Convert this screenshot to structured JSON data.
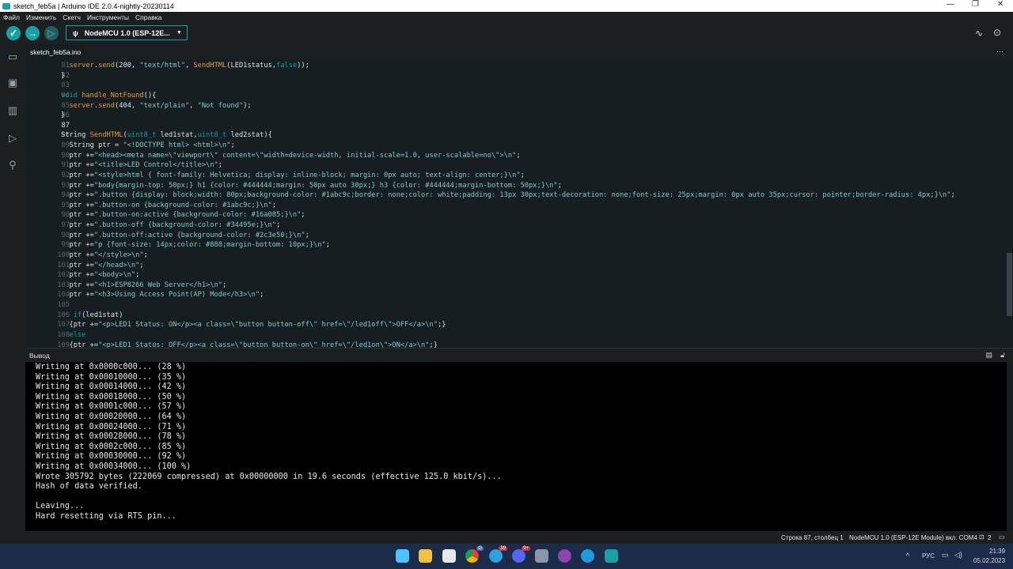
{
  "window": {
    "title": "sketch_feb5a | Arduino IDE 2.0.4-nightly-20230114"
  },
  "menu": [
    "Файл",
    "Изменить",
    "Скетч",
    "Инструменты",
    "Справка"
  ],
  "toolbar": {
    "board": "NodeMCU 1.0 (ESP-12E..."
  },
  "tab": {
    "label": "sketch_feb5a.ino"
  },
  "editor": {
    "current_line": 87,
    "lines": [
      {
        "n": 81,
        "t": [
          [
            "p",
            "  "
          ],
          [
            "f",
            "server"
          ],
          [
            "p",
            "."
          ],
          [
            "f",
            "send"
          ],
          [
            "p",
            "(200, "
          ],
          [
            "s",
            "\"text/html\""
          ],
          [
            "p",
            ", "
          ],
          [
            "f",
            "SendHTML"
          ],
          [
            "p",
            "(LED1status,"
          ],
          [
            "k",
            "false"
          ],
          [
            "p",
            "));"
          ]
        ]
      },
      {
        "n": 82,
        "t": [
          [
            "p",
            "}"
          ]
        ]
      },
      {
        "n": 83,
        "t": []
      },
      {
        "n": 84,
        "t": [
          [
            "k",
            "void"
          ],
          [
            "p",
            " "
          ],
          [
            "f",
            "handle_NotFound"
          ],
          [
            "p",
            "(){"
          ]
        ]
      },
      {
        "n": 85,
        "t": [
          [
            "p",
            "  "
          ],
          [
            "f",
            "server"
          ],
          [
            "p",
            "."
          ],
          [
            "f",
            "send"
          ],
          [
            "p",
            "(404, "
          ],
          [
            "s",
            "\"text/plain\""
          ],
          [
            "p",
            ", "
          ],
          [
            "s",
            "\"Not found\""
          ],
          [
            "p",
            ");"
          ]
        ]
      },
      {
        "n": 86,
        "t": [
          [
            "p",
            "}"
          ]
        ]
      },
      {
        "n": 87,
        "t": []
      },
      {
        "n": 88,
        "t": [
          [
            "p",
            "String "
          ],
          [
            "f",
            "SendHTML"
          ],
          [
            "p",
            "("
          ],
          [
            "k",
            "uint8_t"
          ],
          [
            "p",
            " led1stat,"
          ],
          [
            "k",
            "uint8_t"
          ],
          [
            "p",
            " led2stat){"
          ]
        ]
      },
      {
        "n": 89,
        "t": [
          [
            "p",
            "  String ptr = "
          ],
          [
            "s",
            "\"<!DOCTYPE html> <html>\\n\""
          ],
          [
            "p",
            ";"
          ]
        ]
      },
      {
        "n": 90,
        "t": [
          [
            "p",
            "  ptr +="
          ],
          [
            "s",
            "\"<head><meta name=\\\"viewport\\\" content=\\\"width=device-width, initial-scale=1.0, user-scalable=no\\\">\\n\""
          ],
          [
            "p",
            ";"
          ]
        ]
      },
      {
        "n": 91,
        "t": [
          [
            "p",
            "  ptr +="
          ],
          [
            "s",
            "\"<title>LED Control</title>\\n\""
          ],
          [
            "p",
            ";"
          ]
        ]
      },
      {
        "n": 92,
        "t": [
          [
            "p",
            "  ptr +="
          ],
          [
            "s",
            "\"<style>html { font-family: Helvetica; display: inline-block; margin: 0px auto; text-align: center;}\\n\""
          ],
          [
            "p",
            ";"
          ]
        ]
      },
      {
        "n": 93,
        "t": [
          [
            "p",
            "  ptr +="
          ],
          [
            "s",
            "\"body{margin-top: 50px;} h1 {color: #444444;margin: 50px auto 30px;} h3 {color: #444444;margin-bottom: 50px;}\\n\""
          ],
          [
            "p",
            ";"
          ]
        ]
      },
      {
        "n": 94,
        "t": [
          [
            "p",
            "  ptr +="
          ],
          [
            "s",
            "\".button {display: block;width: 80px;background-color: #1abc9c;border: none;color: white;padding: 13px 30px;text-decoration: none;font-size: 25px;margin: 0px auto 35px;cursor: pointer;border-radius: 4px;}\\n\""
          ],
          [
            "p",
            ";"
          ]
        ]
      },
      {
        "n": 95,
        "t": [
          [
            "p",
            "  ptr +="
          ],
          [
            "s",
            "\".button-on {background-color: #1abc9c;}\\n\""
          ],
          [
            "p",
            ";"
          ]
        ]
      },
      {
        "n": 96,
        "t": [
          [
            "p",
            "  ptr +="
          ],
          [
            "s",
            "\".button-on:active {background-color: #16a085;}\\n\""
          ],
          [
            "p",
            ";"
          ]
        ]
      },
      {
        "n": 97,
        "t": [
          [
            "p",
            "  ptr +="
          ],
          [
            "s",
            "\".button-off {background-color: #34495e;}\\n\""
          ],
          [
            "p",
            ";"
          ]
        ]
      },
      {
        "n": 98,
        "t": [
          [
            "p",
            "  ptr +="
          ],
          [
            "s",
            "\".button-off:active {background-color: #2c3e50;}\\n\""
          ],
          [
            "p",
            ";"
          ]
        ]
      },
      {
        "n": 99,
        "t": [
          [
            "p",
            "  ptr +="
          ],
          [
            "s",
            "\"p {font-size: 14px;color: #888;margin-bottom: 10px;}\\n\""
          ],
          [
            "p",
            ";"
          ]
        ]
      },
      {
        "n": 100,
        "t": [
          [
            "p",
            "  ptr +="
          ],
          [
            "s",
            "\"</style>\\n\""
          ],
          [
            "p",
            ";"
          ]
        ]
      },
      {
        "n": 101,
        "t": [
          [
            "p",
            "  ptr +="
          ],
          [
            "s",
            "\"</head>\\n\""
          ],
          [
            "p",
            ";"
          ]
        ]
      },
      {
        "n": 102,
        "t": [
          [
            "p",
            "  ptr +="
          ],
          [
            "s",
            "\"<body>\\n\""
          ],
          [
            "p",
            ";"
          ]
        ]
      },
      {
        "n": 103,
        "t": [
          [
            "p",
            "  ptr +="
          ],
          [
            "s",
            "\"<h1>ESP8266 Web Server</h1>\\n\""
          ],
          [
            "p",
            ";"
          ]
        ]
      },
      {
        "n": 104,
        "t": [
          [
            "p",
            "  ptr +="
          ],
          [
            "s",
            "\"<h3>Using Access Point(AP) Mode</h3>\\n\""
          ],
          [
            "p",
            ";"
          ]
        ]
      },
      {
        "n": 105,
        "t": []
      },
      {
        "n": 106,
        "t": [
          [
            "p",
            "   "
          ],
          [
            "k",
            "if"
          ],
          [
            "p",
            "(led1stat)"
          ]
        ]
      },
      {
        "n": 107,
        "t": [
          [
            "p",
            "  {ptr +="
          ],
          [
            "s",
            "\"<p>LED1 Status: ON</p><a class=\\\"button button-off\\\" href=\\\"/led1off\\\">OFF</a>\\n\""
          ],
          [
            "p",
            ";}"
          ]
        ]
      },
      {
        "n": 108,
        "t": [
          [
            "p",
            "  "
          ],
          [
            "k",
            "else"
          ]
        ]
      },
      {
        "n": 109,
        "t": [
          [
            "p",
            "  {ptr +="
          ],
          [
            "s",
            "\"<p>LED1 Status: OFF</p><a class=\\\"button button-on\\\" href=\\\"/led1on\\\">ON</a>\\n\""
          ],
          [
            "p",
            ";}"
          ]
        ]
      }
    ]
  },
  "output": {
    "title": "Вывод",
    "lines": [
      "Writing at 0x0000c000... (28 %)",
      "Writing at 0x00010000... (35 %)",
      "Writing at 0x00014000... (42 %)",
      "Writing at 0x00018000... (50 %)",
      "Writing at 0x0001c000... (57 %)",
      "Writing at 0x00020000... (64 %)",
      "Writing at 0x00024000... (71 %)",
      "Writing at 0x00028000... (78 %)",
      "Writing at 0x0002c000... (85 %)",
      "Writing at 0x00030000... (92 %)",
      "Writing at 0x00034000... (100 %)",
      "Wrote 305792 bytes (222069 compressed) at 0x00000000 in 19.6 seconds (effective 125.0 kbit/s)...",
      "Hash of data verified.",
      "",
      "Leaving...",
      "Hard resetting via RTS pin..."
    ]
  },
  "status": {
    "position": "Строка 87, столбец 1",
    "board": "NodeMCU 1.0 (ESP-12E Module) вкл. COM4",
    "notifications": "2"
  },
  "taskbar": {
    "lang": "РУС",
    "time": "21:39",
    "date": "05.02.2023",
    "badges": {
      "chrome": "G",
      "telegram": "39",
      "discord": "9+"
    }
  }
}
